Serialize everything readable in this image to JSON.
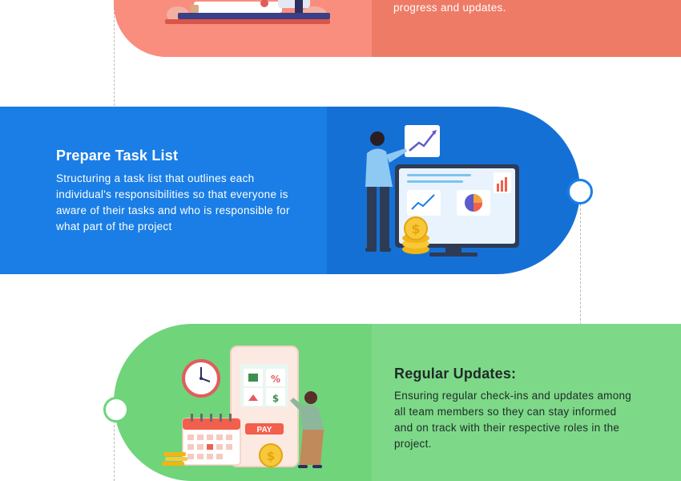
{
  "top_card": {
    "desc": "progress and updates."
  },
  "task_card": {
    "title": "Prepare Task List",
    "desc": "Structuring a task list that outlines each individual's responsibilities so that everyone is aware of their tasks and who is responsible for what part of the project"
  },
  "updates_card": {
    "title": "Regular Updates:",
    "desc": "Ensuring regular check-ins and updates among all team members so they can stay informed and on track with their respective roles in the project.",
    "pay_label": "PAY"
  },
  "icons": [
    "calendar-icon",
    "clock-icon",
    "coins-icon",
    "pie-chart-icon",
    "bar-chart-icon",
    "line-chart-icon"
  ],
  "colors": {
    "top_band": "#ee7b66",
    "top_band_light": "#f98e7e",
    "task_band": "#1a7ee6",
    "task_band_dark": "#1570d6",
    "updates_band": "#6fd47a",
    "updates_band_light": "#7dd987",
    "title_dark": "#1f2a2a"
  }
}
